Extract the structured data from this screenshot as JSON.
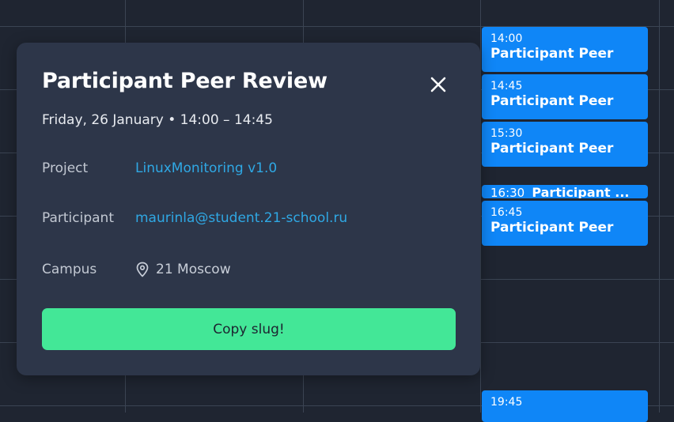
{
  "calendar": {
    "events": [
      {
        "time": "14:00",
        "title": "Participant Peer"
      },
      {
        "time": "14:45",
        "title": "Participant Peer"
      },
      {
        "time": "15:30",
        "title": "Participant Peer"
      },
      {
        "time": "16:30",
        "title": "Participant ..."
      },
      {
        "time": "16:45",
        "title": "Participant Peer"
      },
      {
        "time": "19:45",
        "title": ""
      }
    ]
  },
  "popup": {
    "title": "Participant Peer Review",
    "close_icon": "close-icon",
    "date_time": "Friday, 26 January • 14:00 – 14:45",
    "project_label": "Project",
    "project_value": "LinuxMonitoring v1.0",
    "participant_label": "Participant",
    "participant_value": "maurinla@student.21-school.ru",
    "campus_label": "Campus",
    "campus_icon": "map-pin-icon",
    "campus_value": "21 Moscow",
    "copy_button": "Copy slug!"
  },
  "colors": {
    "background": "#1f2531",
    "popup_bg": "#2d3649",
    "event_bg": "#0f86f7",
    "link": "#2fa8e4",
    "button_bg": "#43e797"
  }
}
